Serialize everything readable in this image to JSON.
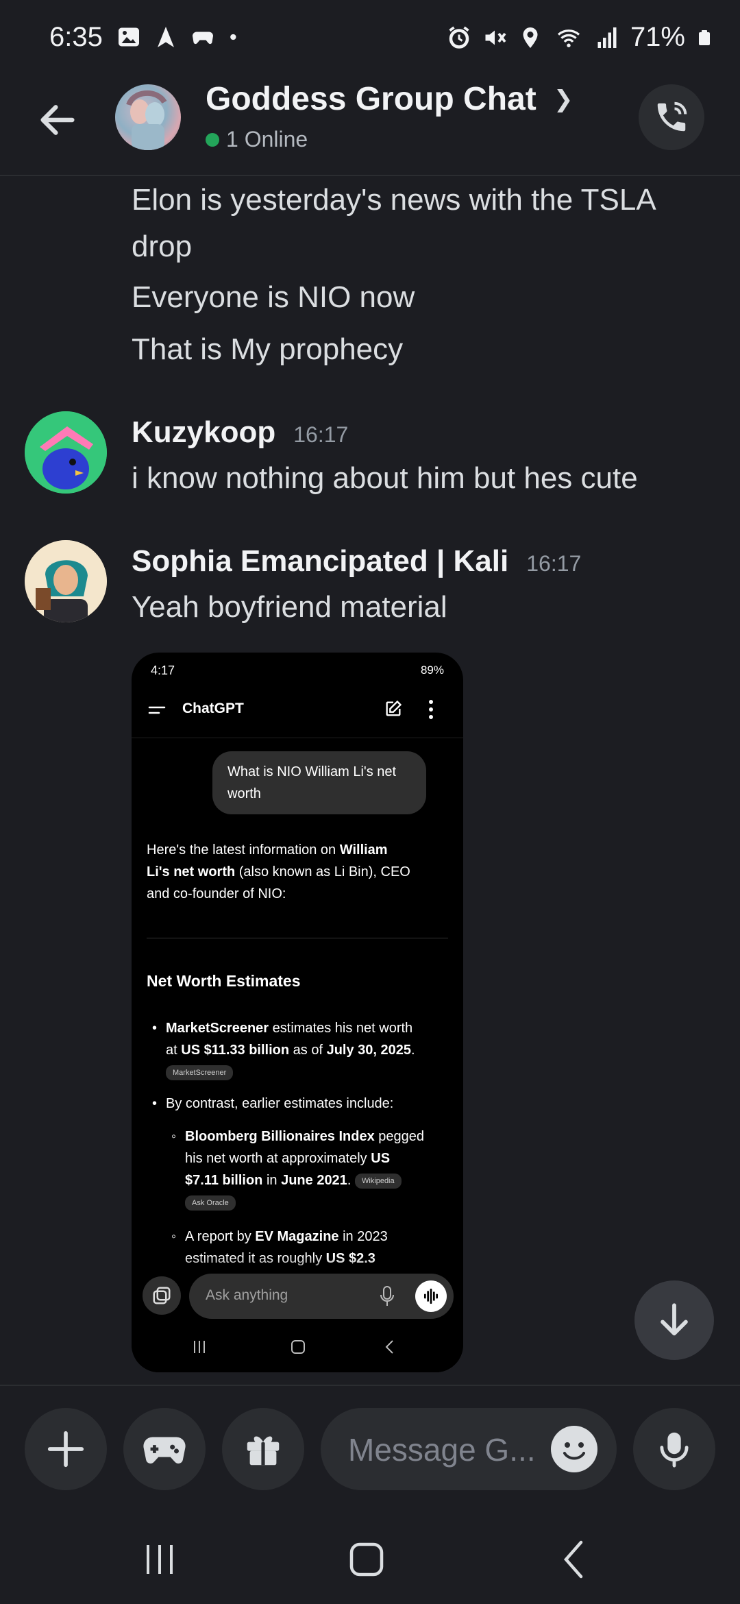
{
  "status_bar": {
    "time": "6:35",
    "battery": "71%",
    "left_icons": [
      "image-icon",
      "navigation-icon",
      "game-controller-icon",
      "dot-icon"
    ],
    "right_icons": [
      "alarm-icon",
      "mute-icon",
      "location-icon",
      "wifi-icon",
      "signal-icon",
      "battery-icon"
    ]
  },
  "header": {
    "title": "Goddess Group Chat",
    "online_text": "1 Online"
  },
  "messages": {
    "continued": [
      "Elon is yesterday's news with the TSLA",
      "drop",
      "Everyone is NIO now",
      "That is My prophecy"
    ],
    "kuzy": {
      "author": "Kuzykoop",
      "time": "16:17",
      "text": "i know nothing about him but hes cute"
    },
    "sophia": {
      "author": "Sophia Emancipated | Kali",
      "time": "16:17",
      "text": "Yeah boyfriend material"
    }
  },
  "embedded": {
    "status_time": "4:17",
    "status_batt": "89%",
    "app_title": "ChatGPT",
    "user_q_1": "What is NIO William Li's net",
    "user_q_2": "worth",
    "intro_1a": "Here's the latest information on ",
    "intro_1b": "William",
    "intro_2a": "Li's net worth",
    "intro_2b": " (also known as Li Bin), CEO",
    "intro_3": "and co-founder of NIO:",
    "heading": "Net Worth Estimates",
    "b1_l1a": "MarketScreener",
    "b1_l1b": " estimates his net worth",
    "b1_l2a": "at ",
    "b1_l2b": "US $11.33 billion",
    "b1_l2c": " as of ",
    "b1_l2d": "July 30, 2025",
    "b1_l2e": ".",
    "chip_marketscreener": "MarketScreener",
    "b2": "By contrast, earlier estimates include:",
    "s1_l1a": "Bloomberg Billionaires Index",
    "s1_l1b": " pegged",
    "s1_l2a": "his net worth at approximately ",
    "s1_l2b": "US",
    "s1_l3a": "$7.11 billion",
    "s1_l3b": " in ",
    "s1_l3c": "June 2021",
    "s1_l3d": ".",
    "chip_wikipedia": "Wikipedia",
    "chip_askoracle": "Ask Oracle",
    "s2_l1a": "A report by ",
    "s2_l1b": "EV Magazine",
    "s2_l1c": " in 2023",
    "s2_l2a": "estimated it as roughly ",
    "s2_l2b": "US $2.3",
    "ask_placeholder": "Ask anything"
  },
  "composer": {
    "placeholder": "Message G..."
  },
  "colors": {
    "background": "#1c1d22",
    "online_green": "#23a55a",
    "text": "#dbdee1"
  }
}
